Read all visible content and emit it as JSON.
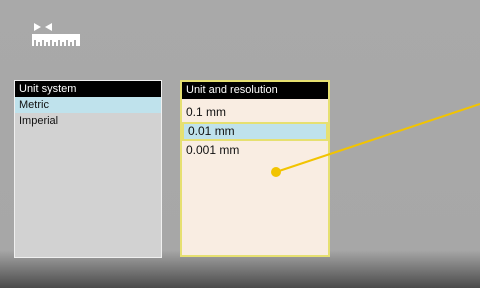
{
  "unit_system": {
    "header": "Unit system",
    "options": [
      "Metric",
      "Imperial"
    ],
    "selected": "Metric"
  },
  "unit_resolution": {
    "header": "Unit and resolution",
    "options": [
      "0.1 mm",
      "0.01 mm",
      "0.001 mm"
    ],
    "selected": "0.01 mm"
  },
  "colors": {
    "header_bg": "#000000",
    "selected_bg": "#bfe2ec",
    "focus_border": "#e6e071",
    "callout": "#f2c400"
  },
  "icons": {
    "top_left": "ruler-measure-icon",
    "callout": "callout-pointer"
  }
}
